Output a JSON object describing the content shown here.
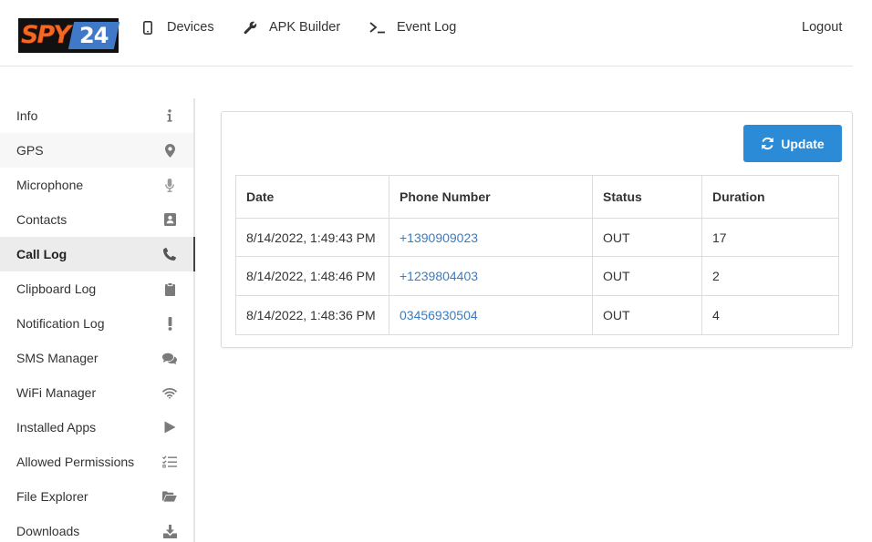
{
  "logo": {
    "left": "SPY",
    "right": "24"
  },
  "nav": {
    "devices": "Devices",
    "apk_builder": "APK Builder",
    "event_log": "Event Log",
    "logout": "Logout"
  },
  "sidebar": {
    "items": [
      {
        "label": "Info",
        "icon": "info-icon"
      },
      {
        "label": "GPS",
        "icon": "map-marker-icon"
      },
      {
        "label": "Microphone",
        "icon": "microphone-icon"
      },
      {
        "label": "Contacts",
        "icon": "address-book-icon"
      },
      {
        "label": "Call Log",
        "icon": "phone-icon",
        "active": true
      },
      {
        "label": "Clipboard Log",
        "icon": "clipboard-icon"
      },
      {
        "label": "Notification Log",
        "icon": "exclamation-icon"
      },
      {
        "label": "SMS Manager",
        "icon": "comments-icon"
      },
      {
        "label": "WiFi Manager",
        "icon": "wifi-icon"
      },
      {
        "label": "Installed Apps",
        "icon": "play-icon"
      },
      {
        "label": "Allowed Permissions",
        "icon": "tasks-icon"
      },
      {
        "label": "File Explorer",
        "icon": "folder-open-icon"
      },
      {
        "label": "Downloads",
        "icon": "download-icon"
      }
    ]
  },
  "main": {
    "update_label": "Update",
    "table": {
      "headers": [
        "Date",
        "Phone Number",
        "Status",
        "Duration"
      ],
      "rows": [
        {
          "date": "8/14/2022, 1:49:43 PM",
          "phone": "+1390909023",
          "status": "OUT",
          "duration": "17"
        },
        {
          "date": "8/14/2022, 1:48:46 PM",
          "phone": "+1239804403",
          "status": "OUT",
          "duration": "2"
        },
        {
          "date": "8/14/2022, 1:48:36 PM",
          "phone": "03456930504",
          "status": "OUT",
          "duration": "4"
        }
      ]
    }
  },
  "colors": {
    "accent": "#2b8bd6",
    "link": "#3b7cc0",
    "logo_orange": "#f26a21",
    "logo_blue": "#3f79c7"
  }
}
